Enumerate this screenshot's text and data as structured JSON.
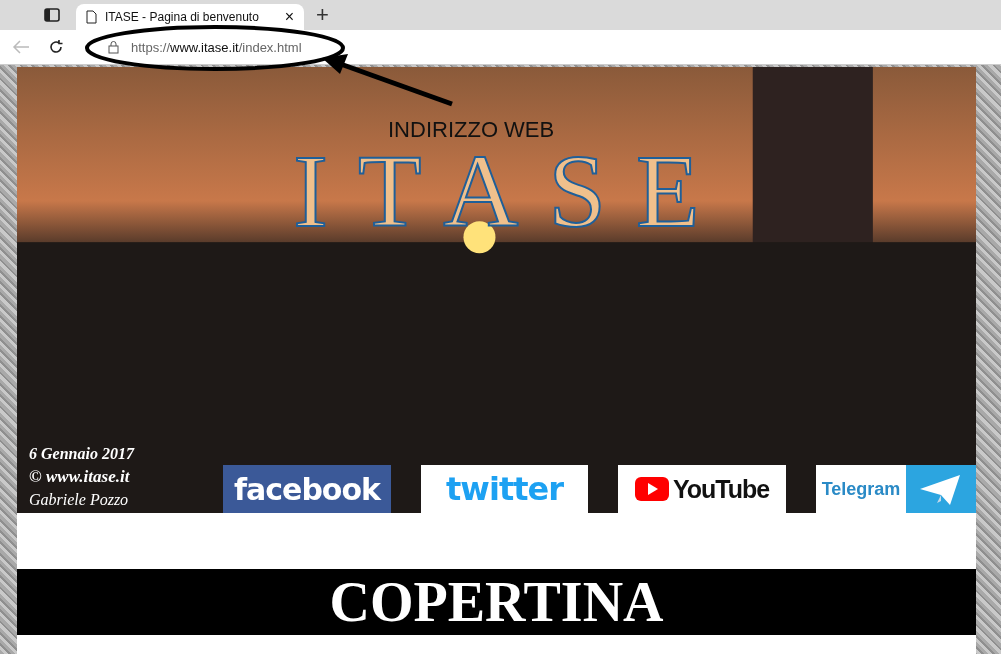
{
  "browser": {
    "tabs": [
      {
        "title": "ITASE - Pagina di benvenuto",
        "selected": true
      }
    ],
    "close_glyph": "×",
    "new_tab_glyph": "+",
    "url": {
      "scheme": "https://",
      "domain": "www.itase.it",
      "path": "/index.html"
    }
  },
  "annotation": {
    "label": "INDIRIZZO WEB"
  },
  "banner": {
    "title": "ITASE",
    "caption_date": "6 Gennaio 2017",
    "caption_copyright": "© www.itase.it",
    "caption_author": "Gabriele Pozzo"
  },
  "social_links": [
    {
      "kind": "facebook",
      "label": "facebook"
    },
    {
      "kind": "twitter",
      "label": "twitter"
    },
    {
      "kind": "youtube",
      "label": "YouTube"
    },
    {
      "kind": "telegram",
      "label": "Telegram"
    }
  ],
  "section": {
    "heading": "COPERTINA"
  }
}
